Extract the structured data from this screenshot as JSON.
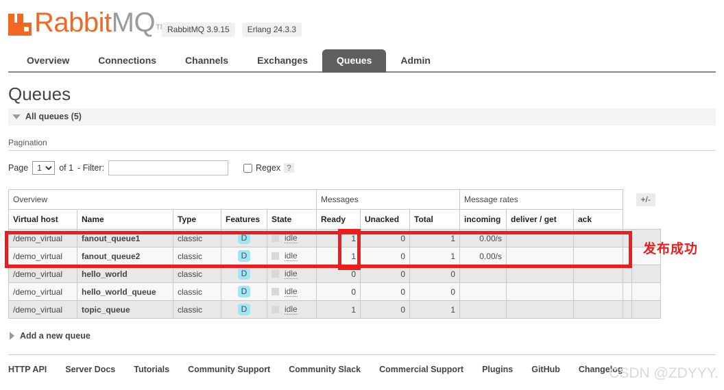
{
  "header": {
    "logo_rabbit": "Rabbit",
    "logo_mq": "MQ",
    "trademark": "TM",
    "version_rabbitmq": "RabbitMQ 3.9.15",
    "version_erlang": "Erlang 24.3.3"
  },
  "nav": {
    "tabs": [
      {
        "label": "Overview",
        "active": false
      },
      {
        "label": "Connections",
        "active": false
      },
      {
        "label": "Channels",
        "active": false
      },
      {
        "label": "Exchanges",
        "active": false
      },
      {
        "label": "Queues",
        "active": true
      },
      {
        "label": "Admin",
        "active": false
      }
    ]
  },
  "page": {
    "title": "Queues",
    "section_label": "All queues (5)",
    "pagination_label": "Pagination",
    "add_queue_label": "Add a new queue"
  },
  "pagination": {
    "page_label": "Page",
    "page_value": "1",
    "page_options": [
      "1"
    ],
    "of_label": "of 1",
    "filter_label": "- Filter:",
    "filter_value": "",
    "filter_placeholder": "",
    "regex_label": "Regex",
    "help_label": "?"
  },
  "table": {
    "group_headers": [
      {
        "label": "Overview",
        "span": 5
      },
      {
        "label": "Messages",
        "span": 3
      },
      {
        "label": "Message rates",
        "span": 3
      }
    ],
    "columns": [
      "Virtual host",
      "Name",
      "Type",
      "Features",
      "State",
      "Ready",
      "Unacked",
      "Total",
      "incoming",
      "deliver / get",
      "ack"
    ],
    "toggle_columns_label": "+/-",
    "feature_badge": "D",
    "state_label": "idle",
    "rows": [
      {
        "vhost": "/demo_virtual",
        "name": "fanout_queue1",
        "type": "classic",
        "features": "D",
        "state": "idle",
        "ready": "1",
        "unacked": "0",
        "total": "1",
        "incoming": "0.00/s",
        "deliver_get": "",
        "ack": ""
      },
      {
        "vhost": "/demo_virtual",
        "name": "fanout_queue2",
        "type": "classic",
        "features": "D",
        "state": "idle",
        "ready": "1",
        "unacked": "0",
        "total": "1",
        "incoming": "0.00/s",
        "deliver_get": "",
        "ack": ""
      },
      {
        "vhost": "/demo_virtual",
        "name": "hello_world",
        "type": "classic",
        "features": "D",
        "state": "idle",
        "ready": "0",
        "unacked": "0",
        "total": "0",
        "incoming": "",
        "deliver_get": "",
        "ack": ""
      },
      {
        "vhost": "/demo_virtual",
        "name": "hello_world_queue",
        "type": "classic",
        "features": "D",
        "state": "idle",
        "ready": "0",
        "unacked": "0",
        "total": "0",
        "incoming": "",
        "deliver_get": "",
        "ack": ""
      },
      {
        "vhost": "/demo_virtual",
        "name": "topic_queue",
        "type": "classic",
        "features": "D",
        "state": "idle",
        "ready": "1",
        "unacked": "0",
        "total": "1",
        "incoming": "",
        "deliver_get": "",
        "ack": ""
      }
    ]
  },
  "annotation": {
    "text": "发布成功",
    "color": "#ee1c1c"
  },
  "footer": {
    "links": [
      "HTTP API",
      "Server Docs",
      "Tutorials",
      "Community Support",
      "Community Slack",
      "Commercial Support",
      "Plugins",
      "GitHub",
      "Changelog"
    ]
  },
  "watermark": {
    "text": "CSDN @ZDYYY."
  },
  "colors": {
    "brand_orange": "#F26722",
    "active_tab": "#605f5f",
    "badge_blue": "#9fe7f5",
    "annotation_red": "#ee1c1c"
  }
}
